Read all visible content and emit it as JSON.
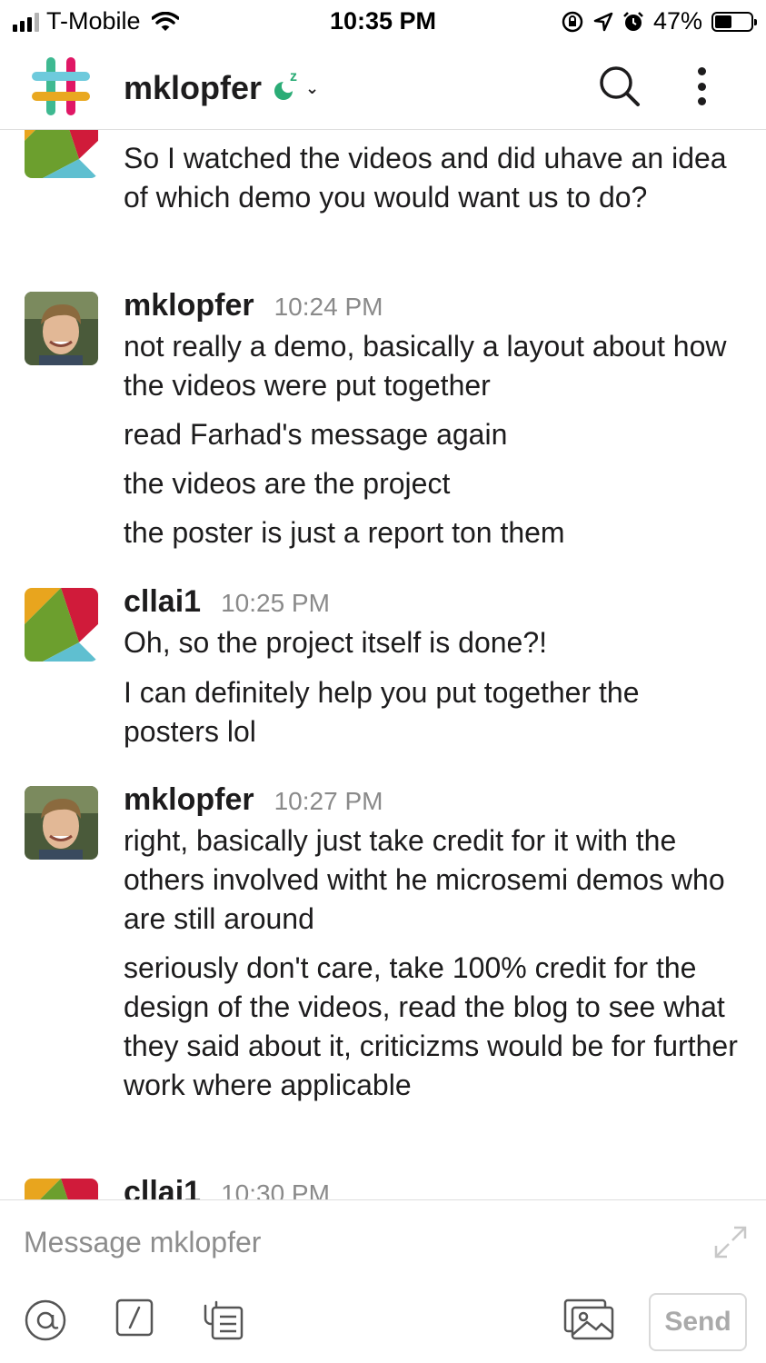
{
  "status_bar": {
    "carrier": "T-Mobile",
    "time": "10:35 PM",
    "battery": "47%",
    "battery_level": 0.47
  },
  "header": {
    "channel_name": "mklopfer",
    "snooze_label": "z"
  },
  "messages": [
    {
      "author": "",
      "time": "",
      "lines": [
        "So I watched the videos and did uhave an idea of which demo you would want us to do?"
      ]
    },
    {
      "author": "mklopfer",
      "time": "10:24 PM",
      "lines": [
        "not really a demo, basically a layout about how the videos were put together",
        "read Farhad's message again",
        "the videos are the project",
        "the poster is just a report ton them"
      ]
    },
    {
      "author": "cllai1",
      "time": "10:25 PM",
      "lines": [
        "Oh, so the project itself is done?!",
        "I can definitely help you put together the posters lol"
      ]
    },
    {
      "author": "mklopfer",
      "time": "10:27 PM",
      "lines": [
        "right, basically just take credit for it with the others involved witht he microsemi demos who are still around",
        "seriously don't care, take 100% credit for the design of the videos, read the blog to see what they said about it, criticizms would be for further work where applicable"
      ]
    },
    {
      "author": "cllai1",
      "time": "10:30 PM",
      "lines": []
    }
  ],
  "composer": {
    "placeholder": "Message mklopfer",
    "send_label": "Send",
    "tools": [
      "at-icon",
      "slash-command-icon",
      "attachment-icon",
      "photo-icon"
    ]
  },
  "colors": {
    "text": "#1d1c1d",
    "muted": "#8a8a8a",
    "divider": "#dedede",
    "snooze_green": "#2bac76"
  }
}
